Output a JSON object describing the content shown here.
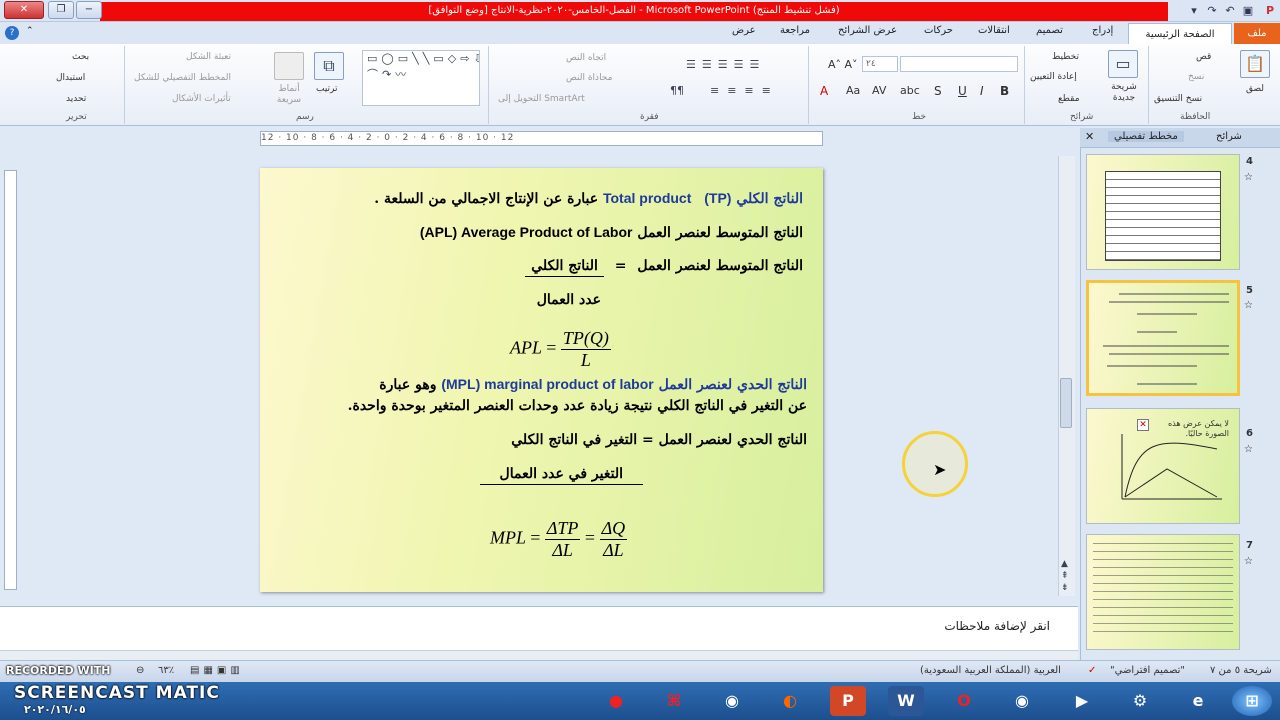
{
  "window": {
    "title": "الفصل-الخامس-٢٠٢٠-نظرية-الانتاج [وضع التوافق] - Microsoft PowerPoint (فشل تنشيط المنتج)"
  },
  "tabs": [
    "ملف",
    "الصفحة الرئيسية",
    "إدراج",
    "تصميم",
    "انتقالات",
    "حركات",
    "عرض الشرائح",
    "مراجعة",
    "عرض"
  ],
  "ribbon": {
    "clipboard": {
      "label": "الحافظة",
      "paste": "لصق",
      "cut": "قص",
      "copy": "نسخ",
      "format_painter": "نسخ التنسيق"
    },
    "slides": {
      "label": "شرائح",
      "new_slide": "شريحة جديدة",
      "layout": "تخطيط",
      "reset": "إعادة التعيين",
      "section": "مقطع"
    },
    "font": {
      "label": "خط",
      "size": "٢٤"
    },
    "paragraph": {
      "label": "فقرة",
      "text_direction": "اتجاه النص",
      "align_text": "محاذاة النص",
      "smartart": "التحويل إلى SmartArt"
    },
    "drawing": {
      "label": "رسم",
      "arrange": "ترتيب",
      "quick_styles": "أنماط سريعة",
      "shape_fill": "تعبئة الشكل",
      "shape_outline": "المخطط التفصيلي للشكل",
      "shape_effects": "تأثيرات الأشكال"
    },
    "editing": {
      "label": "تحرير",
      "find": "بحث",
      "replace": "استبدال",
      "select": "تحديد"
    }
  },
  "ruler": "12 · 10 · 8 · 6 · 4 · 2 · 0 · 2 · 4 · 6 · 8 · 10 · 12",
  "slide": {
    "l1_ar": "الناتج الكلي",
    "l1_en": "Total product",
    "l1_abbr": "(TP)",
    "l1_rest": "عبارة عن الإنتاج الاجمالي من السلعة .",
    "l2_ar": "الناتج المتوسط لعنصر العمل",
    "l2_en": "(APL) Average Product of Labor",
    "l3_lhs": "الناتج المتوسط لعنصر العمل",
    "l3_eq": "=",
    "l3_num": "الناتج الكلي",
    "l4_den": "عدد العمال",
    "apl_lhs": "APL",
    "apl_eq": "=",
    "apl_num": "TP(Q)",
    "apl_den": "L",
    "l5_ar": "الناتج الحدي لعنصر العمل",
    "l5_en": "(MPL) marginal product of labor",
    "l5_rest": "وهو عبارة",
    "l6": "عن التغير في الناتج الكلي نتيجة زيادة عدد وحدات العنصر المتغير بوحدة واحدة.",
    "l7": "الناتج الحدي لعنصر العمل = التغير في الناتج الكلي",
    "l8": "التغير في عدد العمال",
    "mpl_lhs": "MPL",
    "mpl_eq1": "=",
    "mpl_num1": "ΔTP",
    "mpl_den1": "ΔL",
    "mpl_eq2": "=",
    "mpl_num2": "ΔQ",
    "mpl_den2": "ΔL"
  },
  "pane": {
    "tab_slides": "شرائح",
    "tab_outline": "مخطط تفصيلي",
    "slide_numbers": [
      "4",
      "5",
      "6",
      "7"
    ],
    "thumb6_text": "لا يمكن عرض هذه الصورة حاليًا."
  },
  "notes": {
    "placeholder": "انقر لإضافة ملاحظات"
  },
  "status": {
    "slide": "شريحة ٥ من ٧",
    "theme": "\"تصميم افتراضي\"",
    "lang": "العربية (المملكة العربية السعودية)",
    "zoom": "٦٣٪"
  },
  "watermark": {
    "line1": "RECORDED WITH",
    "line2": "SCREENCAST MATIC",
    "date": "٢٠٢٠/١٦/٠٥"
  }
}
